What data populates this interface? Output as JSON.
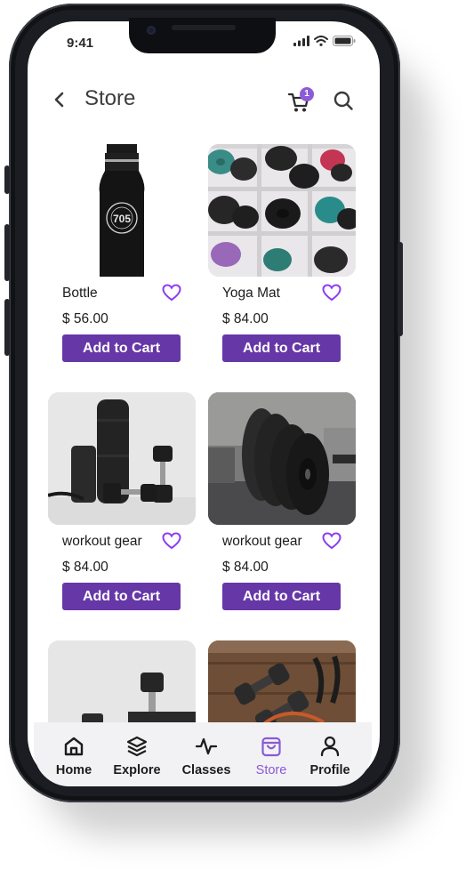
{
  "status_bar": {
    "time": "9:41"
  },
  "header": {
    "title": "Store",
    "cart_count": "1"
  },
  "products": [
    {
      "name": "Bottle",
      "price": "$ 56.00",
      "button": "Add to Cart",
      "image": "black-water-bottle"
    },
    {
      "name": "Yoga Mat",
      "price": "$ 84.00",
      "button": "Add to Cart",
      "image": "rolled-yoga-mats"
    },
    {
      "name": "workout gear",
      "price": "$ 84.00",
      "button": "Add to Cart",
      "image": "foam-roller-dumbbells"
    },
    {
      "name": "workout gear",
      "price": "$ 84.00",
      "button": "Add to Cart",
      "image": "weight-plates"
    },
    {
      "image": "dumbbell-stack"
    },
    {
      "image": "dumbbells-resistance-band"
    }
  ],
  "nav": {
    "items": [
      {
        "label": "Home",
        "icon": "home-icon"
      },
      {
        "label": "Explore",
        "icon": "layers-icon"
      },
      {
        "label": "Classes",
        "icon": "activity-icon"
      },
      {
        "label": "Store",
        "icon": "shopping-bag-icon",
        "active": true
      },
      {
        "label": "Profile",
        "icon": "user-icon"
      }
    ]
  },
  "colors": {
    "accent": "#6637a6",
    "active_nav": "#8a5ad4",
    "heart": "#8c3cf0",
    "badge": "#8d5bd6"
  }
}
